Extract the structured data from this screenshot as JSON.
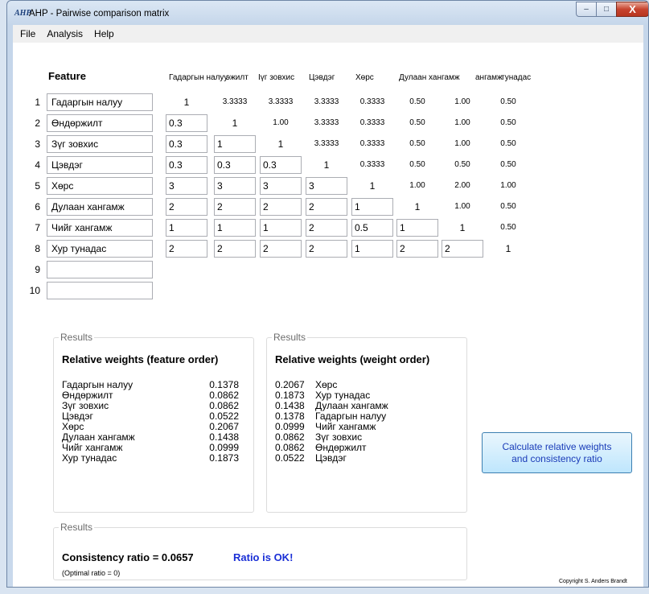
{
  "window": {
    "title": "AHP - Pairwise comparison matrix",
    "app_icon": "AHP"
  },
  "controls": {
    "minimize": "–",
    "maximize": "□",
    "close": "X"
  },
  "menu": [
    "File",
    "Analysis",
    "Help"
  ],
  "matrix": {
    "feature_header": "Feature",
    "column_headers": [
      "Гадаргын налуу",
      "эжилт",
      "Іүг зовхис",
      "Цэвдэг",
      "Хөрс",
      "Дулаан хангамж",
      "ангамж",
      "тунадас"
    ],
    "row_numbers": [
      "1",
      "2",
      "3",
      "4",
      "5",
      "6",
      "7",
      "8",
      "9",
      "10"
    ],
    "features": [
      "Гадаргын налуу",
      "Өндөржилт",
      "Зүг зовхис",
      "Цэвдэг",
      "Хөрс",
      "Дулаан хангамж",
      "Чийг хангамж",
      "Хур тунадас",
      "",
      ""
    ],
    "rows": [
      [
        "1",
        "3.3333",
        "3.3333",
        "3.3333",
        "0.3333",
        "0.50",
        "1.00",
        "0.50"
      ],
      [
        "0.3",
        "1",
        "1.00",
        "3.3333",
        "0.3333",
        "0.50",
        "1.00",
        "0.50"
      ],
      [
        "0.3",
        "1",
        "1",
        "3.3333",
        "0.3333",
        "0.50",
        "1.00",
        "0.50"
      ],
      [
        "0.3",
        "0.3",
        "0.3",
        "1",
        "0.3333",
        "0.50",
        "0.50",
        "0.50"
      ],
      [
        "3",
        "3",
        "3",
        "3",
        "1",
        "1.00",
        "2.00",
        "1.00"
      ],
      [
        "2",
        "2",
        "2",
        "2",
        "1",
        "1",
        "1.00",
        "0.50"
      ],
      [
        "1",
        "1",
        "1",
        "2",
        "0.5",
        "1",
        "1",
        "0.50"
      ],
      [
        "2",
        "2",
        "2",
        "2",
        "1",
        "2",
        "2",
        "1"
      ]
    ]
  },
  "results_feature": {
    "group_label": "Results",
    "heading": "Relative weights (feature order)",
    "items": [
      {
        "name": "Гадаргын налуу",
        "value": "0.1378"
      },
      {
        "name": "Өндөржилт",
        "value": "0.0862"
      },
      {
        "name": "Зүг зовхис",
        "value": "0.0862"
      },
      {
        "name": "Цэвдэг",
        "value": "0.0522"
      },
      {
        "name": "Хөрс",
        "value": "0.2067"
      },
      {
        "name": "Дулаан хангамж",
        "value": "0.1438"
      },
      {
        "name": "Чийг хангамж",
        "value": "0.0999"
      },
      {
        "name": "Хур тунадас",
        "value": "0.1873"
      }
    ]
  },
  "results_weight": {
    "group_label": "Results",
    "heading": "Relative weights (weight order)",
    "items": [
      {
        "value": "0.2067",
        "name": "Хөрс"
      },
      {
        "value": "0.1873",
        "name": "Хур тунадас"
      },
      {
        "value": "0.1438",
        "name": "Дулаан хангамж"
      },
      {
        "value": "0.1378",
        "name": "Гадаргын налуу"
      },
      {
        "value": "0.0999",
        "name": "Чийг хангамж"
      },
      {
        "value": "0.0862",
        "name": "Зүг зовхис"
      },
      {
        "value": "0.0862",
        "name": "Өндөржилт"
      },
      {
        "value": "0.0522",
        "name": "Цэвдэг"
      }
    ]
  },
  "calc_button": {
    "line1": "Calculate relative weights",
    "line2": "and consistency ratio"
  },
  "consistency": {
    "group_label": "Results",
    "ratio_text": "Consistency ratio = 0.0657",
    "status": "Ratio is OK!",
    "optimal": "(Optimal ratio = 0)"
  },
  "copyright": "Copyright S. Anders Brandt",
  "colors": {
    "status_ok": "#1a2fd6",
    "button_text": "#1a3bb8"
  }
}
